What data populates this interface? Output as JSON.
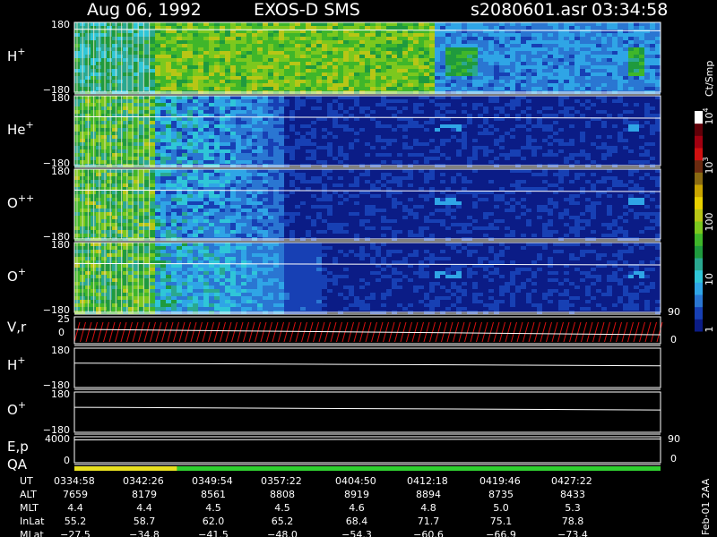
{
  "header": {
    "date": "Aug 06, 1992",
    "mission": "EXOS-D SMS",
    "file": "s2080601.asr",
    "time": "03:34:58"
  },
  "colorbar": {
    "title": "Ct/Smp",
    "tick_labels": [
      "1",
      "10",
      "100",
      "10",
      "10"
    ],
    "tick_exponents": [
      "",
      "",
      "",
      "3",
      "4"
    ],
    "colors": [
      "#0b1c86",
      "#1740b4",
      "#2a76d2",
      "#2fa5e6",
      "#2fc6d8",
      "#2aa890",
      "#1f9a3e",
      "#3fb62a",
      "#7cc81e",
      "#b8c616",
      "#e8d000",
      "#c9a400",
      "#8a6a12",
      "#6b2a10",
      "#d01010",
      "#a00010",
      "#600008",
      "#ffffff"
    ]
  },
  "panels": [
    {
      "label": "H",
      "sup": "+",
      "top": "180",
      "bottom": "−180",
      "kind": "spectrogram",
      "profile": "h"
    },
    {
      "label": "He",
      "sup": "+",
      "top": "180",
      "bottom": "−180",
      "kind": "spectrogram",
      "profile": "he"
    },
    {
      "label": "O",
      "sup": "++",
      "top": "180",
      "bottom": "−180",
      "kind": "spectrogram",
      "profile": "opp"
    },
    {
      "label": "O",
      "sup": "+",
      "top": "180",
      "bottom": "−180",
      "kind": "spectrogram",
      "profile": "op"
    },
    {
      "label": "V,r",
      "sup": "",
      "top": "25",
      "mid": "0",
      "right_top": "90",
      "right_bottom": "0",
      "kind": "line"
    },
    {
      "label": "H",
      "sup": "+",
      "top": "180",
      "bottom": "−180",
      "kind": "line"
    },
    {
      "label": "O",
      "sup": "+",
      "top": "180",
      "bottom": "−180",
      "kind": "line"
    },
    {
      "label": "E,p",
      "label2": "QA",
      "sup": "",
      "top": "4000",
      "bottom": "0",
      "right_top": "90",
      "right_bottom": "0",
      "kind": "line"
    }
  ],
  "qa_bar": {
    "yellow_until_fraction": 0.175,
    "yellow": "#e8e020",
    "green": "#30d030"
  },
  "chart_data": {
    "type": "heatmap",
    "x": [
      "0334:58",
      "0342:26",
      "0349:54",
      "0357:22",
      "0404:50",
      "0412:18",
      "0419:46",
      "0427:22"
    ],
    "rows": [
      {
        "name": "UT",
        "values": [
          "0334:58",
          "0342:26",
          "0349:54",
          "0357:22",
          "0404:50",
          "0412:18",
          "0419:46",
          "0427:22"
        ]
      },
      {
        "name": "ALT",
        "values": [
          "7659",
          "8179",
          "8561",
          "8808",
          "8919",
          "8894",
          "8735",
          "8433"
        ]
      },
      {
        "name": "MLT",
        "values": [
          "4.4",
          "4.4",
          "4.5",
          "4.5",
          "4.6",
          "4.8",
          "5.0",
          "5.3"
        ]
      },
      {
        "name": "InLat",
        "values": [
          "55.2",
          "58.7",
          "62.0",
          "65.2",
          "68.4",
          "71.7",
          "75.1",
          "78.8"
        ]
      },
      {
        "name": "MLat",
        "values": [
          "−27.5",
          "−34.8",
          "−41.5",
          "−48.0",
          "−54.3",
          "−60.6",
          "−66.9",
          "−73.4"
        ]
      }
    ],
    "ylim_pitch": [
      -180,
      180
    ],
    "colorscale": "log",
    "footer_note": "Feb-01 2AA"
  }
}
